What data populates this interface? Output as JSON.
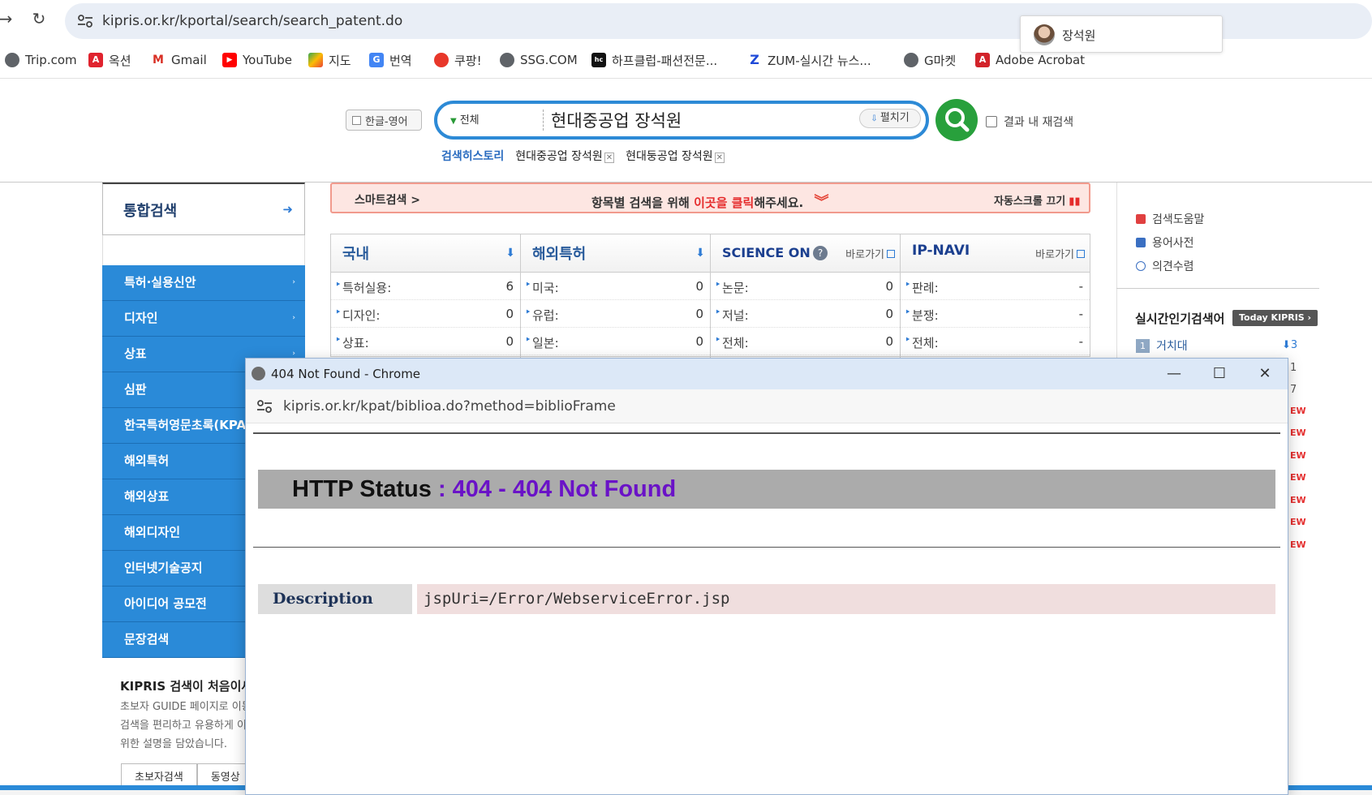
{
  "browser": {
    "url": "kipris.or.kr/kportal/search/search_patent.do",
    "profile_name": "장석원",
    "bookmarks": [
      "Trip.com",
      "옥션",
      "Gmail",
      "YouTube",
      "지도",
      "번역",
      "쿠팡!",
      "SSG.COM",
      "하프클럽-패션전문...",
      "ZUM-실시간 뉴스...",
      "G마켓",
      "Adobe Acrobat"
    ]
  },
  "search": {
    "lang_toggle": "한글-영어",
    "scope": "전체",
    "query": "현대중공업 장석원",
    "expand_label": "펼치기",
    "research_label": "결과 내 재검색",
    "history_label": "검색히스토리",
    "history": [
      "현대중공업 장석원",
      "현대둥공업 장석원"
    ]
  },
  "sidebar": {
    "unified": "통합검색",
    "menu": [
      "특허·실용신안",
      "디자인",
      "상표",
      "심판",
      "한국특허영문초록(KPA)",
      "해외특허",
      "해외상표",
      "해외디자인",
      "인터넷기술공지",
      "아이디어 공모전",
      "문장검색"
    ],
    "guide_title": "KIPRIS 검색이 처음이세요?",
    "guide_lines": [
      "초보자 GUIDE 페이지로 이동",
      "검색을 편리하고 유용하게 이",
      "위한 설명을 담았습니다."
    ],
    "guide_tabs": [
      "초보자검색",
      "동영상"
    ]
  },
  "smart_bar": {
    "left": "스마트검색 >",
    "center_pre": "항목별 검색을 위해 ",
    "center_red": "이곳을 클릭",
    "center_post": "해주세요.",
    "right": "자동스크롤 끄기"
  },
  "counts": {
    "domestic": {
      "title": "국내",
      "rows": [
        {
          "label": "특허실용:",
          "value": "6"
        },
        {
          "label": "디자인:",
          "value": "0"
        },
        {
          "label": "상표:",
          "value": "0"
        }
      ]
    },
    "overseas": {
      "title": "해외특허",
      "rows": [
        {
          "label": "미국:",
          "value": "0"
        },
        {
          "label": "유럽:",
          "value": "0"
        },
        {
          "label": "일본:",
          "value": "0"
        }
      ]
    },
    "scienceon": {
      "title": "SCIENCE ON",
      "link": "바로가기",
      "rows": [
        {
          "label": "논문:",
          "value": "0"
        },
        {
          "label": "저널:",
          "value": "0"
        },
        {
          "label": "전체:",
          "value": "0"
        }
      ]
    },
    "ipnavi": {
      "title": "IP-NAVI",
      "link": "바로가기",
      "rows": [
        {
          "label": "판례:",
          "value": "-"
        },
        {
          "label": "분쟁:",
          "value": "-"
        },
        {
          "label": "전체:",
          "value": "-"
        }
      ]
    }
  },
  "right": {
    "links": [
      "검색도움말",
      "용어사전",
      "의견수렴"
    ],
    "popular_title": "실시간인기검색어",
    "today_badge": "Today KIPRIS ›",
    "first_rank": "1",
    "first_keyword": "거치대",
    "first_trend": "⬇3",
    "peek_numbers": [
      "1",
      "7"
    ],
    "peek_new": [
      "EW",
      "EW",
      "EW",
      "EW",
      "EW",
      "EW",
      "EW"
    ]
  },
  "popup": {
    "title": "404 Not Found - Chrome",
    "url": "kipris.or.kr/kpat/biblioa.do?method=biblioFrame",
    "status_key": "HTTP Status",
    "status_value": " : 404 - 404 Not Found",
    "desc_label": "Description",
    "desc_value": "jspUri=/Error/WebserviceError.jsp"
  },
  "colors": {
    "menu_blue": "#2a8ad8",
    "search_green": "#28a03c",
    "status_purple": "#6a12c7",
    "smart_bar_bg": "#fde6e2"
  }
}
